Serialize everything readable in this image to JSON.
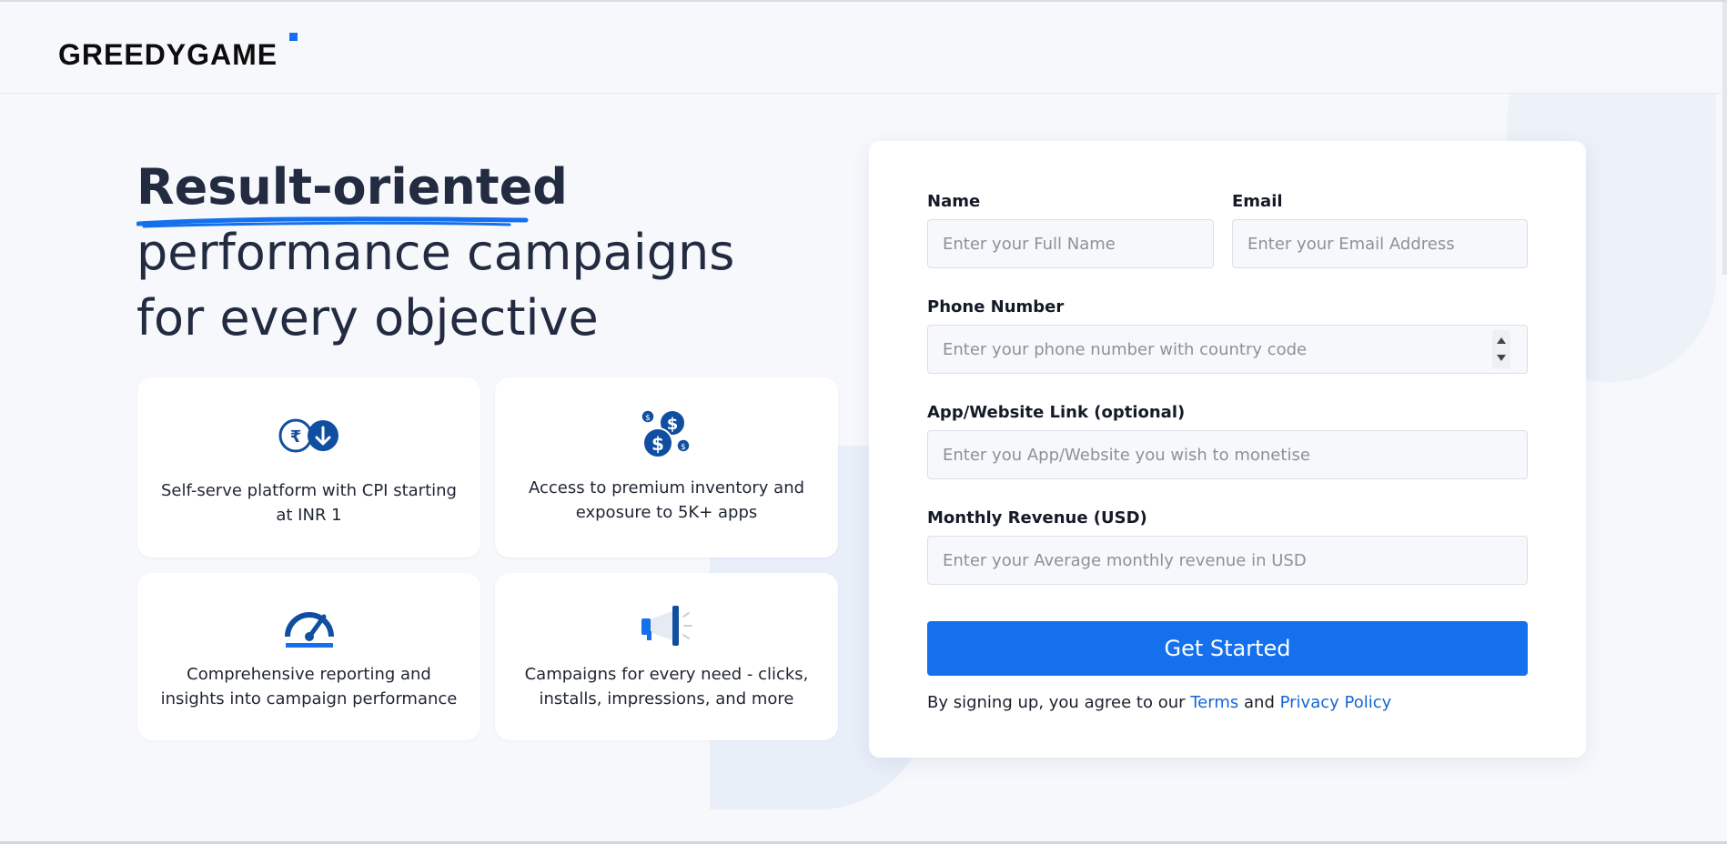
{
  "brand": {
    "logo_text": "GREEDYGAME",
    "accent_color": "#1470ec",
    "text_color": "#222b40"
  },
  "hero": {
    "bold": "Result-oriented",
    "line2": "performance campaigns",
    "line3": "for every objective"
  },
  "features": [
    {
      "icon": "rupee-down-icon",
      "text": "Self-serve platform with CPI starting at INR 1"
    },
    {
      "icon": "coins-dollar-icon",
      "text": "Access to premium inventory and exposure to 5K+ apps"
    },
    {
      "icon": "speedometer-icon",
      "text": "Comprehensive reporting and insights into campaign performance"
    },
    {
      "icon": "megaphone-icon",
      "text": "Campaigns for every need - clicks, installs, impressions, and more"
    }
  ],
  "form": {
    "name": {
      "label": "Name",
      "placeholder": "Enter your Full Name"
    },
    "email": {
      "label": "Email",
      "placeholder": "Enter your Email Address"
    },
    "phone": {
      "label": "Phone Number",
      "placeholder": "Enter your phone number with country code"
    },
    "link": {
      "label": "App/Website Link (optional)",
      "placeholder": "Enter you App/Website you wish to monetise"
    },
    "revenue": {
      "label": "Monthly Revenue (USD)",
      "placeholder": "Enter your Average monthly revenue in USD"
    },
    "submit_label": "Get Started",
    "legal_prefix": "By signing up, you agree to our",
    "terms_link": "Terms",
    "legal_and": "and",
    "privacy_link": "Privacy Policy"
  }
}
